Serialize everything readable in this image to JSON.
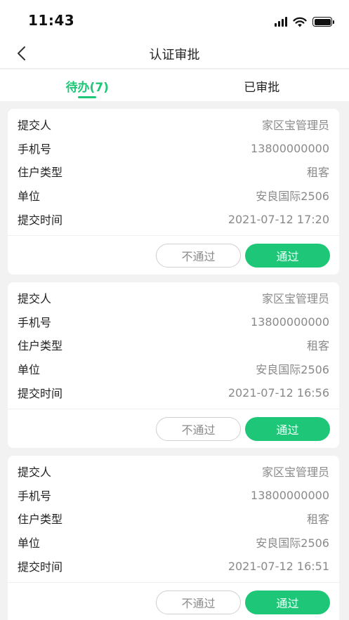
{
  "status_bar": {
    "time": "11:43"
  },
  "nav": {
    "title": "认证审批"
  },
  "tabs": [
    {
      "label": "待办(7)",
      "active": true
    },
    {
      "label": "已审批",
      "active": false
    }
  ],
  "field_labels": {
    "submitter": "提交人",
    "phone": "手机号",
    "resident_type": "住户类型",
    "unit": "单位",
    "submit_time": "提交时间"
  },
  "actions": {
    "reject": "不通过",
    "approve": "通过"
  },
  "records": [
    {
      "submitter": "家区宝管理员",
      "phone": "13800000000",
      "resident_type": "租客",
      "unit": "安良国际2506",
      "submit_time": "2021-07-12 17:20"
    },
    {
      "submitter": "家区宝管理员",
      "phone": "13800000000",
      "resident_type": "租客",
      "unit": "安良国际2506",
      "submit_time": "2021-07-12 16:56"
    },
    {
      "submitter": "家区宝管理员",
      "phone": "13800000000",
      "resident_type": "租客",
      "unit": "安良国际2506",
      "submit_time": "2021-07-12 16:51"
    }
  ],
  "colors": {
    "accent": "#1ec778",
    "text": "#222222",
    "muted": "#8a8a8a",
    "background": "#f2f2f2"
  },
  "icons": {
    "back": "chevron-left-icon",
    "signal": "cellular-signal-icon",
    "wifi": "wifi-icon",
    "battery": "battery-icon"
  }
}
